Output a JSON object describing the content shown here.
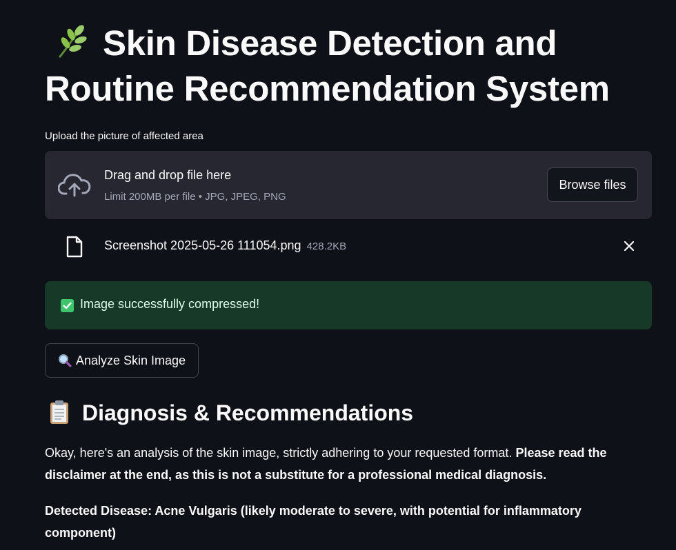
{
  "app": {
    "title": "Skin Disease Detection and Routine Recommendation System",
    "title_icon": "herb-icon"
  },
  "uploader": {
    "label": "Upload the picture of affected area",
    "drop_title": "Drag and drop file here",
    "limit_text": "Limit 200MB per file • JPG, JPEG, PNG",
    "browse_label": "Browse files",
    "icons": {
      "upload": "cloud-upload-icon",
      "file": "file-icon",
      "remove": "close-icon"
    },
    "file": {
      "name": "Screenshot 2025-05-26 111054.png",
      "size": "428.2KB"
    }
  },
  "status": {
    "icon": "check-mark-icon",
    "message": "Image successfully compressed!",
    "color": "#173928"
  },
  "actions": {
    "analyze_icon": "magnifying-glass-icon",
    "analyze_label": "Analyze Skin Image"
  },
  "results": {
    "heading_icon": "clipboard-icon",
    "heading": "Diagnosis & Recommendations",
    "intro_plain": "Okay, here's an analysis of the skin image, strictly adhering to your requested format. ",
    "intro_bold": "Please read the disclaimer at the end, as this is not a substitute for a professional medical diagnosis.",
    "detected": "Detected Disease: Acne Vulgaris (likely moderate to severe, with potential for inflammatory component)"
  },
  "colors": {
    "background": "#0e1117",
    "surface": "#262730",
    "text": "#fafafa",
    "muted": "#a3a8b8",
    "success_bg": "#173928",
    "success_text": "#dffde9"
  }
}
